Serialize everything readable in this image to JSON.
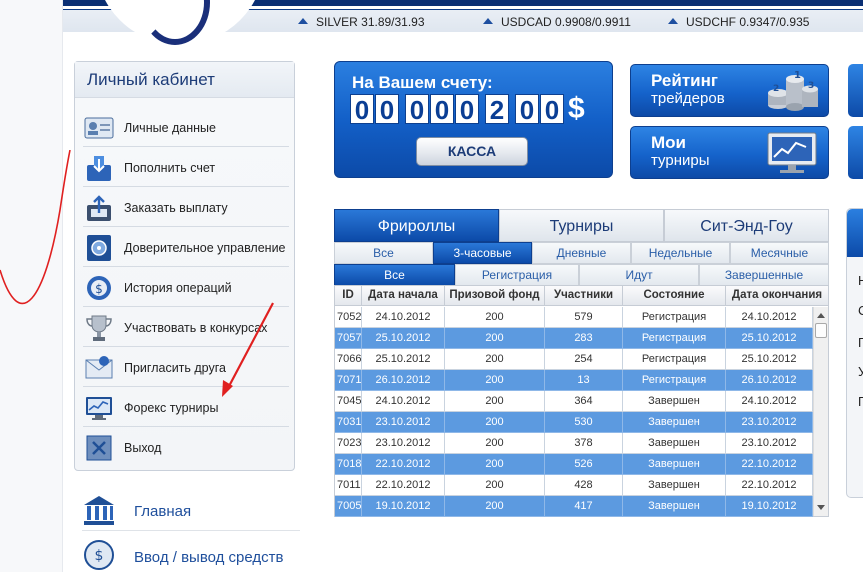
{
  "ticker": [
    {
      "symbol": "SILVER",
      "value": "31.89/31.93"
    },
    {
      "symbol": "USDCAD",
      "value": "0.9908/0.9911"
    },
    {
      "symbol": "USDCHF",
      "value": "0.9347/0.935"
    }
  ],
  "cabinet": {
    "title": "Личный кабинет",
    "items": [
      {
        "label": "Личные данные",
        "icon": "id-card-icon"
      },
      {
        "label": "Пополнить счет",
        "icon": "deposit-icon"
      },
      {
        "label": "Заказать выплату",
        "icon": "withdraw-icon"
      },
      {
        "label": "Доверительное управление",
        "icon": "safe-icon"
      },
      {
        "label": "История операций",
        "icon": "history-icon"
      },
      {
        "label": "Участвовать в конкурсах",
        "icon": "trophy-icon"
      },
      {
        "label": "Пригласить друга",
        "icon": "invite-envelope-icon"
      },
      {
        "label": "Форекс турниры",
        "icon": "monitor-chart-icon"
      },
      {
        "label": "Выход",
        "icon": "exit-icon"
      }
    ]
  },
  "nav": [
    {
      "label": "Главная",
      "icon": "bank-icon"
    },
    {
      "label": "Ввод / вывод средств",
      "icon": "exchange-icon"
    }
  ],
  "account": {
    "title": "На Вашем счету:",
    "digits_int": [
      "0",
      "0",
      "0",
      "0",
      "0",
      "2"
    ],
    "digits_dec": [
      "0",
      "0"
    ],
    "currency": "$",
    "cash_button": "КАССА"
  },
  "promos": [
    {
      "line1": "Рейтинг",
      "line2": "трейдеров",
      "icon": "coins-ranking-icon"
    },
    {
      "line1": "Мои",
      "line2": "турниры",
      "icon": "monitor-chart-icon"
    }
  ],
  "edge_letters": [
    "Н",
    "С",
    "П",
    "У",
    "П"
  ],
  "tabs": [
    {
      "label": "Фрироллы",
      "active": true
    },
    {
      "label": "Турниры",
      "active": false
    },
    {
      "label": "Сит-Энд-Гоу",
      "active": false
    }
  ],
  "period_tabs": [
    {
      "label": "Все",
      "active": false
    },
    {
      "label": "3-часовые",
      "active": true
    },
    {
      "label": "Дневные",
      "active": false
    },
    {
      "label": "Недельные",
      "active": false
    },
    {
      "label": "Месячные",
      "active": false
    }
  ],
  "status_tabs": [
    {
      "label": "Все",
      "active": true
    },
    {
      "label": "Регистрация",
      "active": false
    },
    {
      "label": "Идут",
      "active": false
    },
    {
      "label": "Завершенные",
      "active": false
    }
  ],
  "table": {
    "columns": [
      "ID",
      "Дата начала",
      "Призовой фонд",
      "Участники",
      "Состояние",
      "Дата окончания"
    ],
    "rows": [
      [
        "7052",
        "24.10.2012",
        "200",
        "579",
        "Регистрация",
        "24.10.2012"
      ],
      [
        "7057",
        "25.10.2012",
        "200",
        "283",
        "Регистрация",
        "25.10.2012"
      ],
      [
        "7066",
        "25.10.2012",
        "200",
        "254",
        "Регистрация",
        "25.10.2012"
      ],
      [
        "7071",
        "26.10.2012",
        "200",
        "13",
        "Регистрация",
        "26.10.2012"
      ],
      [
        "7045",
        "24.10.2012",
        "200",
        "364",
        "Завершен",
        "24.10.2012"
      ],
      [
        "7031",
        "23.10.2012",
        "200",
        "530",
        "Завершен",
        "23.10.2012"
      ],
      [
        "7023",
        "23.10.2012",
        "200",
        "378",
        "Завершен",
        "23.10.2012"
      ],
      [
        "7018",
        "22.10.2012",
        "200",
        "526",
        "Завершен",
        "22.10.2012"
      ],
      [
        "7011",
        "22.10.2012",
        "200",
        "428",
        "Завершен",
        "22.10.2012"
      ],
      [
        "7005",
        "19.10.2012",
        "200",
        "417",
        "Завершен",
        "19.10.2012"
      ]
    ]
  },
  "colors": {
    "brand_blue": "#1360c8",
    "dark_blue": "#0c4aa8",
    "row_highlight": "#5c9ae0",
    "arrow_red": "#e02020"
  }
}
